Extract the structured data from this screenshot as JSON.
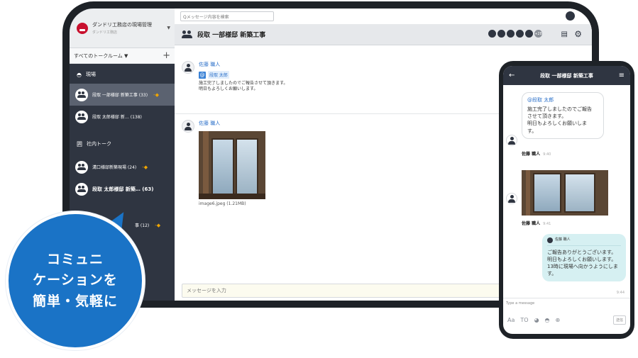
{
  "tablet": {
    "search_placeholder": "Qメッセージ内容を検索",
    "brand": {
      "title": "ダンドリ工務店の現場管理",
      "subtitle": "ダンドリ工務店"
    },
    "rooms_header": {
      "label": "すべてのトークルーム ▼",
      "add": "+"
    },
    "groups": [
      {
        "icon": "◓",
        "label": "現場"
      },
      {
        "icon": "囲",
        "label": "社内トーク"
      }
    ],
    "rooms": [
      {
        "label": "段取 一部様邸 新築工事 (33)",
        "pin": "-◆"
      },
      {
        "label": "段取 太郎様邸  新…  (138)",
        "pin": ""
      },
      {
        "label": "溝口様邸新築現場  (24)",
        "pin": "-◆"
      },
      {
        "label": "段取 太郎様邸  新築… (63)",
        "pin": ""
      },
      {
        "label": "事 (12)",
        "pin": "-◆"
      }
    ],
    "room_title": "段取 一部様邸 新築工事",
    "member_more": "+28",
    "messages": [
      {
        "sender": "佐藤 職人",
        "mention": "段取 太郎",
        "lines": [
          "施工完了しましたのでご報告させて頂きます。",
          "明日もよろしくお願いします。"
        ]
      },
      {
        "sender": "佐藤 職人",
        "attachment": "image6.jpeg (1.21MB)"
      }
    ],
    "composer_placeholder": "メッセージを入力"
  },
  "phone": {
    "title": "段取 一部様邸 新築工事",
    "bubble1": {
      "mention": "@段取 太郎",
      "lines": [
        "施工完了しましたのでご報告",
        "させて頂きます。",
        "明日もよろしくお願いしま",
        "す。"
      ]
    },
    "sender1": "佐藤 職人",
    "time1": "9:40",
    "sender2": "佐藤 職人",
    "time2": "9:41",
    "reply": {
      "quoted": "佐藤 職人",
      "lines": [
        "ご報告ありがとうございます。",
        "明日もよろしくお願いします。",
        "13時に現場へ向かうようにしま",
        "す。"
      ],
      "time": "9:44"
    },
    "input_placeholder": "Type a message",
    "tools": [
      "Aa",
      "TO"
    ],
    "send": "送信"
  },
  "callout": {
    "lines": [
      "コミュニ",
      "ケーションを",
      "簡単・気軽に"
    ],
    "color": "#1a73c6"
  }
}
